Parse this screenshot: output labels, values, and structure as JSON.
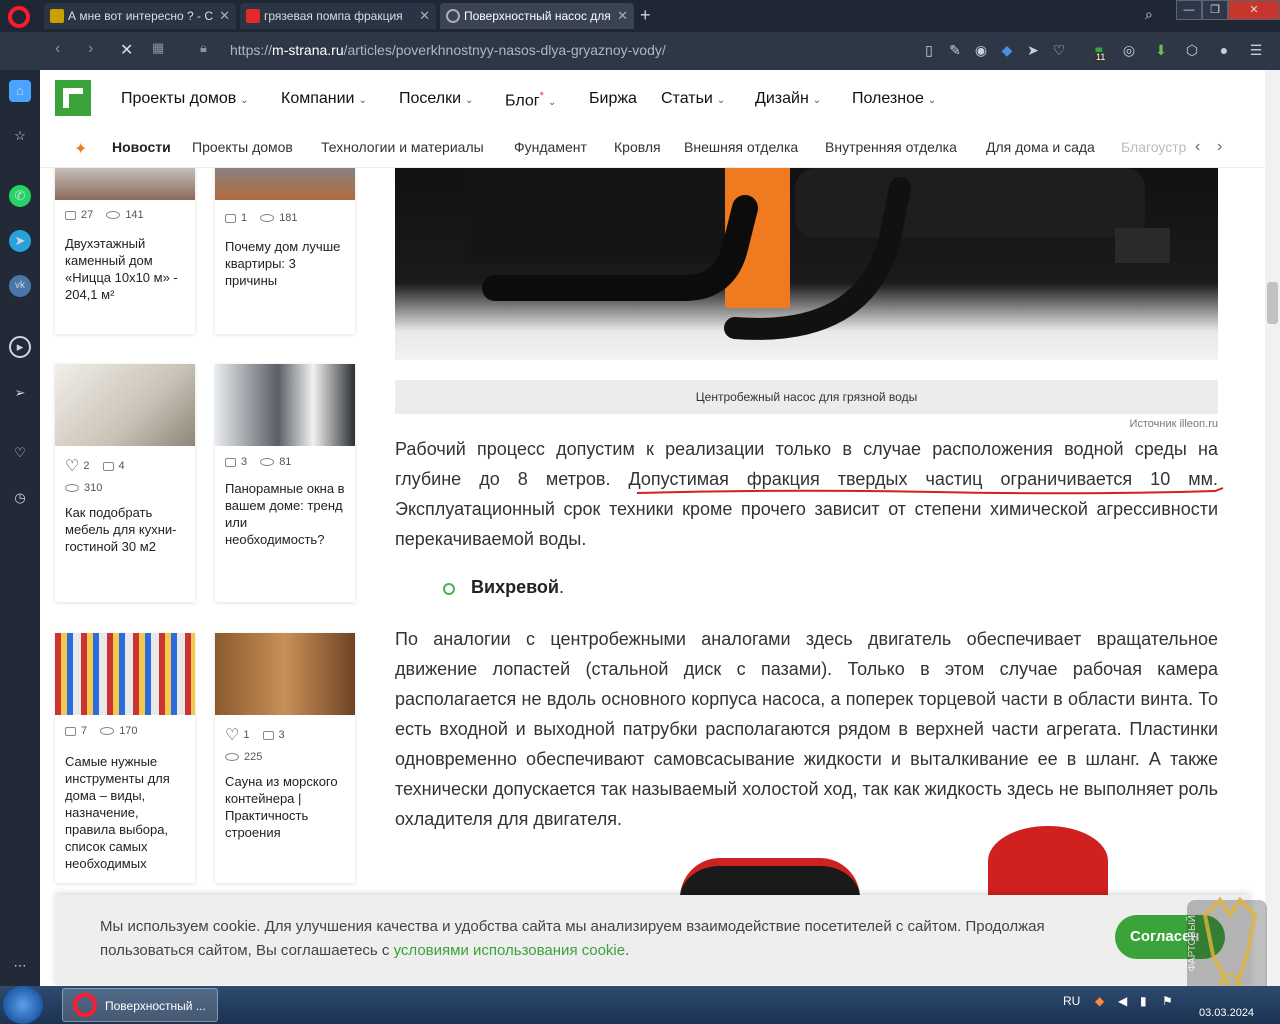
{
  "browser": {
    "tabs": [
      {
        "title": "А мне вот интересно ? - С"
      },
      {
        "title": "грязевая помпа фракция"
      },
      {
        "title": "Поверхностный насос для"
      }
    ],
    "url_prefix": "https://",
    "url_host": "m-strana.ru",
    "url_path": "/articles/poverkhnostnyy-nasos-dlya-gryaznoy-vody/",
    "extension_badge": "11"
  },
  "site": {
    "main_nav": [
      "Проекты домов",
      "Компании",
      "Поселки",
      "Блог",
      "Биржа",
      "Статьи",
      "Дизайн",
      "Полезное"
    ],
    "blog_star": "*",
    "sub_nav": [
      "Новости",
      "Проекты домов",
      "Технологии и материалы",
      "Фундамент",
      "Кровля",
      "Внешняя отделка",
      "Внутренняя отделка",
      "Для дома и сада",
      "Благоустр"
    ]
  },
  "cards": [
    {
      "photos": "27",
      "views": "141",
      "title": "Двухэтажный каменный дом «Ницца 10х10 м» - 204,1 м²"
    },
    {
      "photos": "1",
      "views": "181",
      "title": "Почему дом лучше квартиры: 3 причины"
    },
    {
      "likes": "2",
      "photos": "4",
      "views": "310",
      "title": "Как подобрать мебель для кухни-гостиной 30 м2"
    },
    {
      "photos": "3",
      "views": "81",
      "title": "Панорамные окна в вашем доме: тренд или необходимость?"
    },
    {
      "photos": "7",
      "views": "170",
      "title": "Самые нужные инструменты для дома – виды, назначение, правила выбора, список самых необходимых"
    },
    {
      "likes": "1",
      "photos": "3",
      "views": "225",
      "title": "Сауна из морского контейнера | Практичность строения"
    }
  ],
  "article": {
    "image_caption": "Центробежный насос для грязной воды",
    "image_source": "Источник illeon.ru",
    "paragraph1": "Рабочий процесс допустим к реализации только в случае расположения водной среды на глубине до 8 метров. Допустимая фракция твердых частиц ограничивается 10 мм. Эксплуатационный срок техники кроме прочего зависит от степени химической агрессивности перекачиваемой воды.",
    "bullet": "Вихревой",
    "bullet_suffix": ".",
    "paragraph2": "По аналогии с центробежными аналогами здесь двигатель обеспечивает вращательное движение лопастей (стальной диск с пазами). Только в этом случае рабочая камера располагается не вдоль основного корпуса насоса, а поперек торцевой части в области винта. То есть входной и выходной патрубки располагаются рядом в верхней части агрегата. Пластинки одновременно обеспечивают самовсасывание жидкости и выталкивание ее в шланг. А также технически допускается так называемый холостой ход, так как жидкость здесь не выполняет роль охладителя для двигателя."
  },
  "cookie": {
    "text": "Мы используем cookie. Для улучшения качества и удобства сайта мы анализируем взаимодействие посетителей с сайтом. Продолжая пользоваться сайтом, Вы соглашаетесь с",
    "link": "условиями использования cookie",
    "end": ".",
    "button": "Согласен"
  },
  "taskbar": {
    "window_title": "Поверхностный ...",
    "lang": "RU",
    "date": "03.03.2024"
  },
  "watermark_text": "ФАРТОВЫЙ"
}
